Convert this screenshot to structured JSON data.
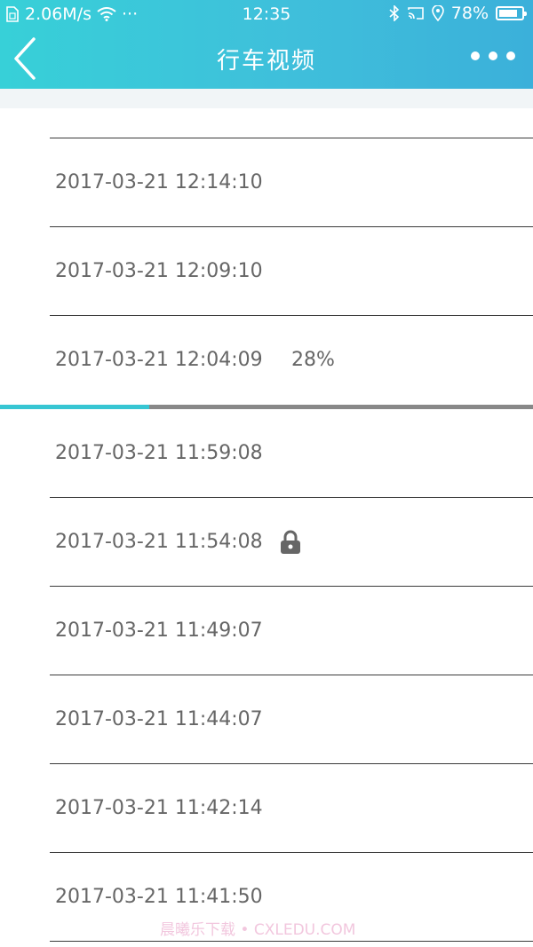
{
  "status_bar": {
    "speed": "2.06M/s",
    "more": "···",
    "time": "12:35",
    "battery": "78%"
  },
  "header": {
    "title": "行车视频"
  },
  "colors": {
    "header_start": "#37d0d8",
    "header_end": "#3bb0da",
    "progress": "#37c6d3",
    "text": "#666666"
  },
  "recordings": [
    {
      "timestamp": "2017-03-21 12:14:10"
    },
    {
      "timestamp": "2017-03-21 12:09:10"
    },
    {
      "timestamp": "2017-03-21 12:04:09",
      "progress_text": "28%"
    },
    {
      "timestamp": "2017-03-21 11:59:08"
    },
    {
      "timestamp": "2017-03-21 11:54:08",
      "icon": "lock-icon"
    },
    {
      "timestamp": "2017-03-21 11:49:07"
    },
    {
      "timestamp": "2017-03-21 11:44:07"
    },
    {
      "timestamp": "2017-03-21 11:42:14"
    },
    {
      "timestamp": "2017-03-21 11:41:50"
    }
  ],
  "download_progress": 0.28,
  "watermark": "晨曦乐下载 • CXLEDU.COM"
}
